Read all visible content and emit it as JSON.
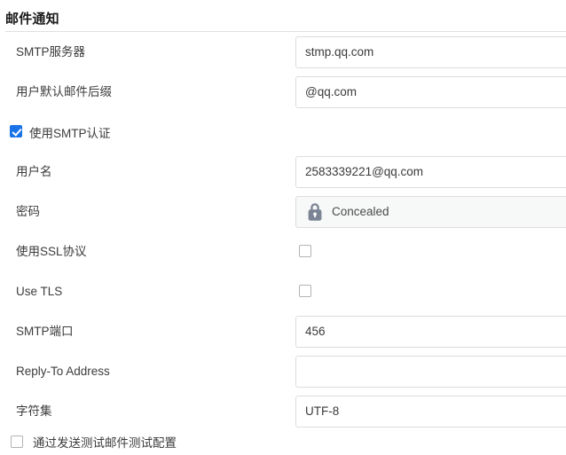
{
  "section": {
    "title": "邮件通知"
  },
  "fields": [
    {
      "kind": "text",
      "name": "smtp-server",
      "label": "SMTP服务器",
      "value": "stmp.qq.com",
      "placeholder": ""
    },
    {
      "kind": "text",
      "name": "default-mail-suffix",
      "label": "用户默认邮件后缀",
      "value": "@qq.com",
      "placeholder": ""
    },
    {
      "kind": "checkbox-inline",
      "name": "use-smtp-auth",
      "label": "使用SMTP认证",
      "checked": true
    },
    {
      "kind": "text",
      "name": "username",
      "label": "用户名",
      "value": "2583339221@qq.com",
      "placeholder": ""
    },
    {
      "kind": "password",
      "name": "password",
      "label": "密码",
      "value": "Concealed",
      "icon": "lock-icon"
    },
    {
      "kind": "checkbox-field",
      "name": "use-ssl",
      "label": "使用SSL协议",
      "checked": false
    },
    {
      "kind": "checkbox-field",
      "name": "use-tls",
      "label": "Use TLS",
      "checked": false
    },
    {
      "kind": "text",
      "name": "smtp-port",
      "label": "SMTP端口",
      "value": "456",
      "placeholder": ""
    },
    {
      "kind": "text",
      "name": "reply-to-address",
      "label": "Reply-To Address",
      "value": "",
      "placeholder": ""
    },
    {
      "kind": "text",
      "name": "charset",
      "label": "字符集",
      "value": "UTF-8",
      "placeholder": ""
    }
  ],
  "bottom_check": {
    "label": "通过发送测试邮件测试配置",
    "checked": false
  },
  "colors": {
    "accent": "#1a73e8",
    "text": "#3c3c3c",
    "title": "#1b1b1b",
    "field_border": "#dcdcdc",
    "readonly_bg": "#f7f8f8",
    "lock_icon": "#7b8494",
    "rule": "#e0e0e0"
  }
}
